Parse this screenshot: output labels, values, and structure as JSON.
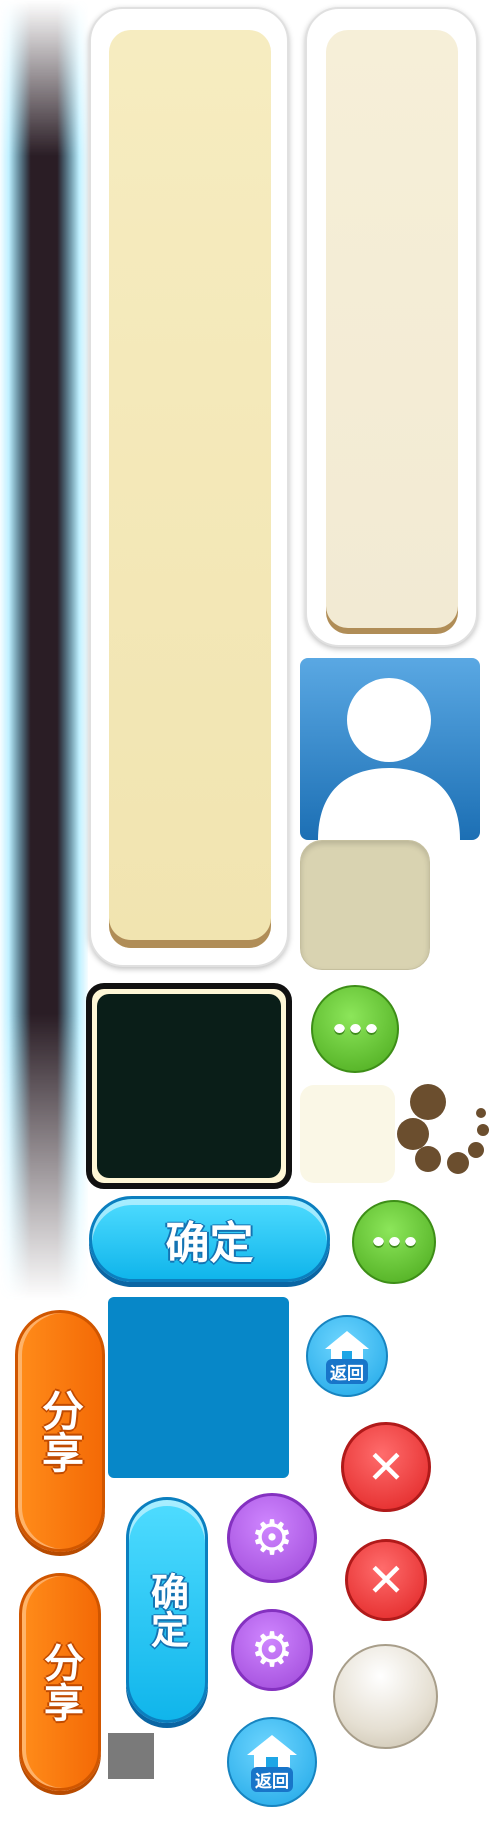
{
  "buttons": {
    "confirm_horizontal": "确定",
    "confirm_vertical": "确定",
    "share_top": "分享",
    "share_bottom": "分享",
    "home_top": "返回",
    "home_bottom": "返回"
  },
  "icons": {
    "chat_top": "chat-bubble-icon",
    "chat_bottom": "chat-bubble-icon",
    "close": "close-icon",
    "gear": "gear-icon",
    "user": "user-avatar-icon",
    "loader": "loading-spinner-icon"
  },
  "colors": {
    "primary_blue": "#1ea6e6",
    "confirm_cyan": "#10b5eb",
    "share_orange": "#f46a06",
    "close_red": "#e02323",
    "chat_green": "#4aa81c",
    "gear_purple": "#9e48d8",
    "panel_cream": "#f1e4b0",
    "spinner_brown": "#6b4e2e",
    "dark_frame": "#0a1e18"
  }
}
